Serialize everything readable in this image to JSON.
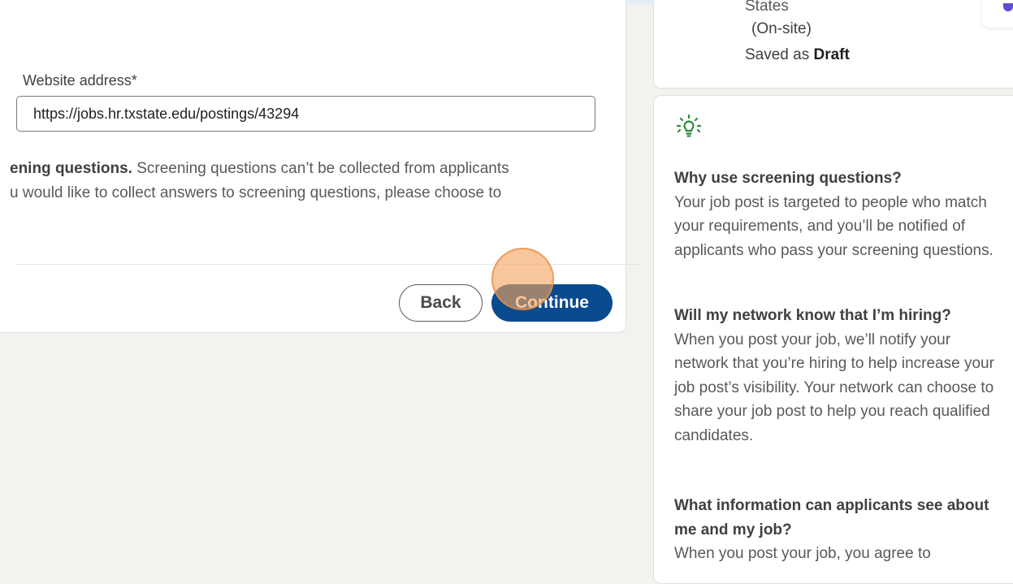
{
  "form": {
    "website_label": "Website address*",
    "website_value": "https://jobs.hr.txstate.edu/postings/43294",
    "screening_bold": "ening questions.",
    "screening_line1_rest": " Screening questions can’t be collected from applicants",
    "screening_line2": "u would like to collect answers to screening questions, please choose to",
    "back_label": "Back",
    "continue_label": "Continue"
  },
  "summary": {
    "line1": "States",
    "line2": "(On-site)",
    "line3_prefix": "Saved as ",
    "line3_bold": "Draft"
  },
  "help": {
    "icon": "lightbulb-icon",
    "items": [
      {
        "question": "Why use screening questions?",
        "answer": "Your job post is targeted to people who match your requirements, and you’ll be notified of applicants who pass your screening questions."
      },
      {
        "question": "Will my network know that I’m hiring?",
        "answer": "When you post your job, we’ll notify your network that you’re hiring to help increase your job post’s visibility. Your network can choose to share your job post to help you reach qualified candidates."
      },
      {
        "question": "What information can applicants see about me and my job?",
        "answer": "When you post your job, you agree to"
      }
    ]
  },
  "colors": {
    "primary_button": "#0a4a8f",
    "page_bg": "#f4f2ee",
    "bulb": "#2e8b3a",
    "click_indicator": "#f4a560"
  }
}
